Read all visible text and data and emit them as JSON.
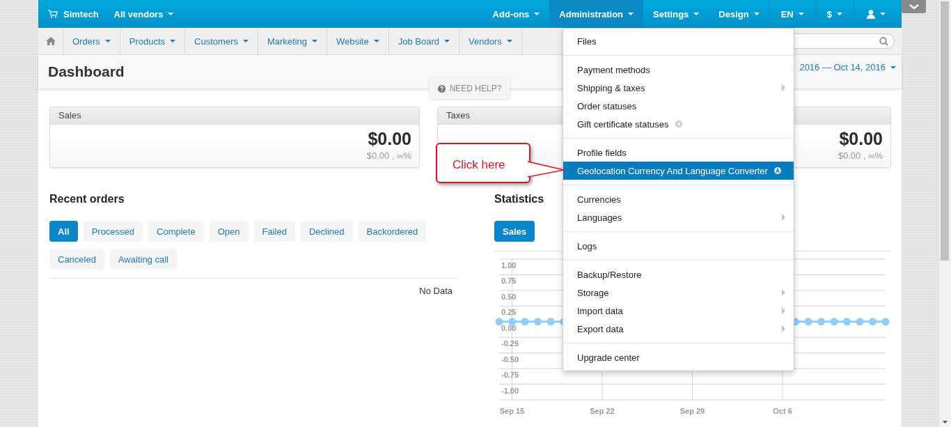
{
  "topbar": {
    "brand": "Simtech",
    "vendor": "All vendors",
    "menu": [
      {
        "label": "Add-ons",
        "selected": false
      },
      {
        "label": "Administration",
        "selected": true
      },
      {
        "label": "Settings",
        "selected": false
      },
      {
        "label": "Design",
        "selected": false
      }
    ],
    "language": "EN",
    "currency": "$"
  },
  "nav": [
    "Orders",
    "Products",
    "Customers",
    "Marketing",
    "Website",
    "Job Board",
    "Vendors"
  ],
  "page_title": "Dashboard",
  "date_range": "2016 — Oct 14, 2016",
  "help": "NEED HELP?",
  "cards": [
    {
      "title": "Sales",
      "value": "$0.00",
      "change": "$0.00 , ∞%"
    },
    {
      "title": "Taxes",
      "value": "$0.00",
      "change": "$0.00 , ∞%"
    }
  ],
  "recent_orders": {
    "title": "Recent orders",
    "empty": "No Data",
    "filters": [
      {
        "label": "All",
        "selected": true
      },
      {
        "label": "Processed",
        "selected": false
      },
      {
        "label": "Complete",
        "selected": false
      },
      {
        "label": "Open",
        "selected": false
      },
      {
        "label": "Failed",
        "selected": false
      },
      {
        "label": "Declined",
        "selected": false
      },
      {
        "label": "Backordered",
        "selected": false
      },
      {
        "label": "Canceled",
        "selected": false
      },
      {
        "label": "Awaiting call",
        "selected": false
      }
    ]
  },
  "statistics": {
    "title": "Statistics",
    "tabs": [
      {
        "label": "Sales",
        "selected": true
      }
    ],
    "chart_data": {
      "type": "line",
      "categories": [
        null,
        "Sep 15",
        null,
        null,
        null,
        null,
        null,
        null,
        "Sep 22",
        null,
        null,
        null,
        null,
        null,
        null,
        "Sep 29",
        null,
        null,
        null,
        null,
        null,
        null,
        "Oct 6",
        null,
        null,
        null,
        null,
        null,
        null,
        null,
        null
      ],
      "series": [
        {
          "color": "#90cdf8",
          "marker": true,
          "values": [
            0,
            0,
            0,
            0,
            0,
            0,
            null,
            null,
            null,
            null,
            null,
            null,
            null,
            null,
            null,
            null,
            null,
            null,
            null,
            null,
            null,
            null,
            null,
            0,
            0,
            0,
            0,
            0,
            0,
            0,
            0
          ]
        }
      ],
      "grid": true,
      "ylim": [
        -1.25,
        1
      ],
      "yticks": [
        {
          "value": 1,
          "label": "1.00"
        },
        {
          "value": 0.75,
          "label": "0.75"
        },
        {
          "value": 0.5,
          "label": "0.50"
        },
        {
          "value": 0.25,
          "label": "0.25"
        },
        {
          "value": 0,
          "label": "0.00"
        },
        {
          "value": -0.25,
          "label": "-0.25"
        },
        {
          "value": -0.5,
          "label": "-0.50"
        },
        {
          "value": -0.75,
          "label": "-0.75"
        },
        {
          "value": -1,
          "label": "-1.00"
        }
      ]
    }
  },
  "admin_menu": [
    [
      {
        "label": "Files",
        "submenu": false,
        "addon": false,
        "selected": false
      }
    ],
    [
      {
        "label": "Payment methods",
        "submenu": false,
        "addon": false,
        "selected": false
      },
      {
        "label": "Shipping & taxes",
        "submenu": true,
        "addon": false,
        "selected": false
      },
      {
        "label": "Order statuses",
        "submenu": false,
        "addon": false,
        "selected": false
      },
      {
        "label": "Gift certificate statuses",
        "submenu": false,
        "addon": true,
        "selected": false
      }
    ],
    [
      {
        "label": "Profile fields",
        "submenu": false,
        "addon": false,
        "selected": false
      },
      {
        "label": "Geolocation Currency And Language Converter",
        "submenu": false,
        "addon": true,
        "selected": true
      }
    ],
    [
      {
        "label": "Currencies",
        "submenu": false,
        "addon": false,
        "selected": false
      },
      {
        "label": "Languages",
        "submenu": true,
        "addon": false,
        "selected": false
      }
    ],
    [
      {
        "label": "Logs",
        "submenu": false,
        "addon": false,
        "selected": false
      }
    ],
    [
      {
        "label": "Backup/Restore",
        "submenu": false,
        "addon": false,
        "selected": false
      },
      {
        "label": "Storage",
        "submenu": true,
        "addon": false,
        "selected": false
      },
      {
        "label": "Import data",
        "submenu": true,
        "addon": false,
        "selected": false
      },
      {
        "label": "Export data",
        "submenu": true,
        "addon": false,
        "selected": false
      }
    ],
    [
      {
        "label": "Upgrade center",
        "submenu": false,
        "addon": false,
        "selected": false
      }
    ]
  ],
  "callout": "Click here"
}
